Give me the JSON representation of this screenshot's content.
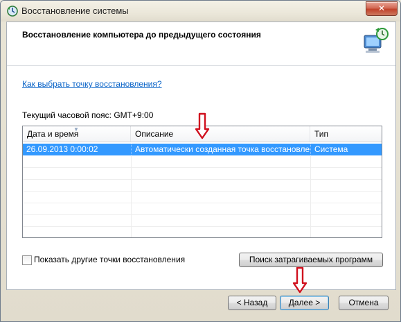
{
  "window": {
    "title": "Восстановление системы",
    "close_label": "✕"
  },
  "header": {
    "title": "Восстановление компьютера до предыдущего состояния"
  },
  "help_link": "Как выбрать точку восстановления?",
  "timezone": "Текущий часовой пояс: GMT+9:00",
  "table": {
    "columns": [
      "Дата и время",
      "Описание",
      "Тип"
    ],
    "rows": [
      {
        "date": "26.09.2013 0:00:02",
        "description": "Автоматически созданная точка восстановле...",
        "type": "Система",
        "selected": true
      }
    ]
  },
  "show_more": {
    "label": "Показать другие точки восстановления",
    "checked": false
  },
  "buttons": {
    "scan": "Поиск затрагиваемых программ",
    "back": "< Назад",
    "next": "Далее >",
    "cancel": "Отмена"
  },
  "colors": {
    "selection": "#3399ff",
    "link": "#0a64c8",
    "annotation_arrow": "#d0101e"
  }
}
